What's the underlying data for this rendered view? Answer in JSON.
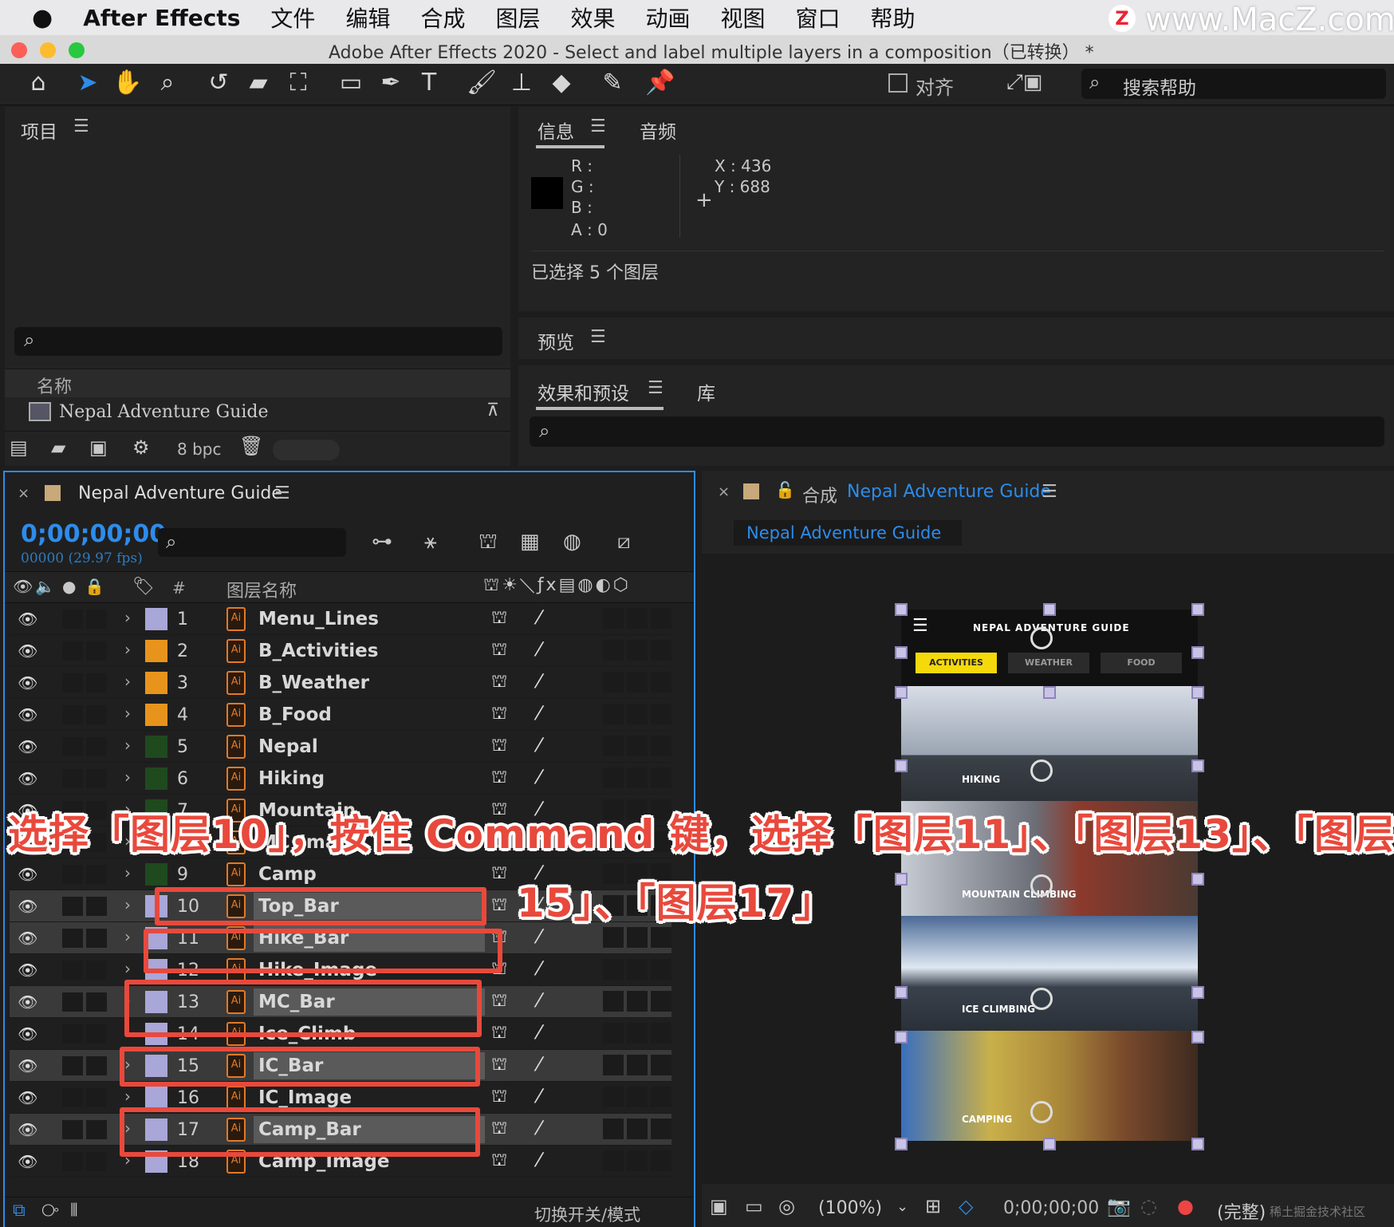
{
  "menubar": {
    "apple": "",
    "app": "After Effects",
    "items": [
      "文件",
      "编辑",
      "合成",
      "图层",
      "效果",
      "动画",
      "视图",
      "窗口",
      "帮助"
    ],
    "watermark": "www.MacZ.com",
    "watermark_badge": "Z"
  },
  "window": {
    "title": "Adobe After Effects 2020 - Select and label multiple layers in a composition（已转换） *"
  },
  "toolbar": {
    "align_label": "对齐",
    "search_help": "搜索帮助"
  },
  "project": {
    "title": "项目",
    "col_name": "名称",
    "item": "Nepal Adventure Guide",
    "bpc": "8 bpc"
  },
  "info": {
    "tab": "信息",
    "tab2": "音频",
    "r": "R :",
    "g": "G :",
    "b": "B :",
    "a": "A :  0",
    "x": "X :  436",
    "y": "Y :  688",
    "status": "已选择 5 个图层"
  },
  "preview": {
    "title": "预览"
  },
  "effects": {
    "tab": "效果和预设",
    "tab2": "库"
  },
  "timeline": {
    "comp": "Nepal Adventure Guide",
    "timecode": "0;00;00;00",
    "fps": "00000 (29.97 fps)",
    "col_name": "图层名称",
    "col_num": "#",
    "footer": "切换开关/模式",
    "layers": [
      {
        "num": "1",
        "name": "Menu_Lines",
        "color": "#a9a6d8",
        "selected": false
      },
      {
        "num": "2",
        "name": "B_Activities",
        "color": "#e8941c",
        "selected": false
      },
      {
        "num": "3",
        "name": "B_Weather",
        "color": "#e8941c",
        "selected": false
      },
      {
        "num": "4",
        "name": "B_Food",
        "color": "#e8941c",
        "selected": false
      },
      {
        "num": "5",
        "name": "Nepal",
        "color": "#1e4a1e",
        "selected": false
      },
      {
        "num": "6",
        "name": "Hiking",
        "color": "#1e4a1e",
        "selected": false
      },
      {
        "num": "7",
        "name": "Mountain",
        "color": "#1e4a1e",
        "selected": false
      },
      {
        "num": "8",
        "name": "MC_Image",
        "color": "#1e4a1e",
        "selected": false
      },
      {
        "num": "9",
        "name": "Camp",
        "color": "#1e4a1e",
        "selected": false
      },
      {
        "num": "10",
        "name": "Top_Bar",
        "color": "#a9a6d8",
        "selected": true
      },
      {
        "num": "11",
        "name": "Hike_Bar",
        "color": "#a9a6d8",
        "selected": true
      },
      {
        "num": "12",
        "name": "Hike_Image",
        "color": "#a9a6d8",
        "selected": false
      },
      {
        "num": "13",
        "name": "MC_Bar",
        "color": "#a9a6d8",
        "selected": true
      },
      {
        "num": "14",
        "name": "Ice_Climb",
        "color": "#a9a6d8",
        "selected": false
      },
      {
        "num": "15",
        "name": "IC_Bar",
        "color": "#a9a6d8",
        "selected": true
      },
      {
        "num": "16",
        "name": "IC_Image",
        "color": "#a9a6d8",
        "selected": false
      },
      {
        "num": "17",
        "name": "Camp_Bar",
        "color": "#a9a6d8",
        "selected": true
      },
      {
        "num": "18",
        "name": "Camp_Image",
        "color": "#a9a6d8",
        "selected": false
      }
    ]
  },
  "composition": {
    "prefix": "合成",
    "name": "Nepal Adventure Guide",
    "tab": "Nepal Adventure Guide",
    "zoom": "(100%)",
    "timecode": "0;00;00;00",
    "quality": "(完整)",
    "footer_watermark": "稀土掘金技术社区"
  },
  "phone": {
    "title": "NEPAL ADVENTURE GUIDE",
    "tabs": [
      "ACTIVITIES",
      "WEATHER",
      "FOOD"
    ],
    "sections": [
      "HIKING",
      "MOUNTAIN CLIMBING",
      "ICE CLIMBING",
      "CAMPING"
    ]
  },
  "caption": {
    "line1": "选择「图层10」，按住 Command 键，选择「图层11」、「图层13」、「图层",
    "line2": "15」、「图层17」"
  },
  "colors": {
    "accent": "#2d8ceb",
    "highlight": "#e8493c",
    "tab_active": "#f5d90a"
  }
}
